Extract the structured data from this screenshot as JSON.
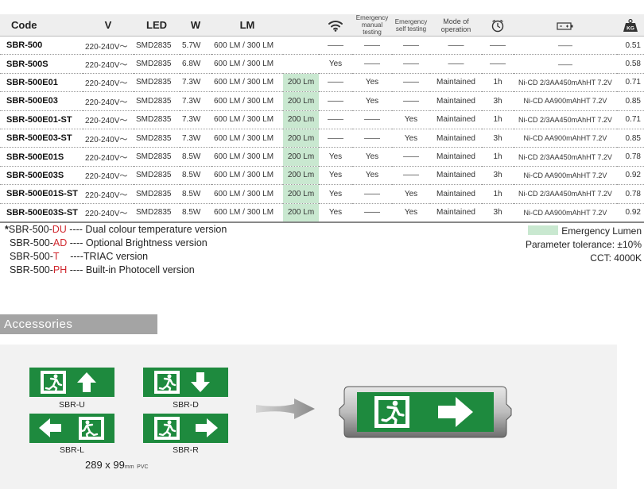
{
  "table": {
    "headers": {
      "code": "Code",
      "v": "V",
      "led": "LED",
      "w": "W",
      "lm": "LM",
      "wifi_icon": "wifi-icon",
      "em_manual": [
        "Emergency",
        "manual testing"
      ],
      "em_self": [
        "Emergency",
        "self testing"
      ],
      "mode": [
        "Mode of",
        "operation"
      ],
      "clock_icon": "clock-icon",
      "battery_icon": "battery-icon",
      "weight_icon": "weight-kg-icon",
      "weight_label": "KG"
    },
    "rows": [
      {
        "code": "SBR-500",
        "v": "220-240V～",
        "led": "SMD2835",
        "w": "5.7W",
        "lm": "600 LM / 300 LM",
        "em": "",
        "wifi": "——",
        "manual": "——",
        "self": "——",
        "mode": "——",
        "hours": "——",
        "battery": "——",
        "kg": "0.51"
      },
      {
        "code": "SBR-500S",
        "v": "220-240V～",
        "led": "SMD2835",
        "w": "6.8W",
        "lm": "600 LM / 300 LM",
        "em": "",
        "wifi": "Yes",
        "manual": "——",
        "self": "——",
        "mode": "——",
        "hours": "——",
        "battery": "——",
        "kg": "0.58"
      },
      {
        "code": "SBR-500E01",
        "v": "220-240V～",
        "led": "SMD2835",
        "w": "7.3W",
        "lm": "600 LM / 300 LM",
        "em": "200 Lm",
        "wifi": "——",
        "manual": "Yes",
        "self": "——",
        "mode": "Maintained",
        "hours": "1h",
        "battery": "Ni-CD 2/3AA450mAhHT 7.2V",
        "kg": "0.71"
      },
      {
        "code": "SBR-500E03",
        "v": "220-240V～",
        "led": "SMD2835",
        "w": "7.3W",
        "lm": "600 LM / 300 LM",
        "em": "200 Lm",
        "wifi": "——",
        "manual": "Yes",
        "self": "——",
        "mode": "Maintained",
        "hours": "3h",
        "battery": "Ni-CD AA900mAhHT 7.2V",
        "kg": "0.85"
      },
      {
        "code": "SBR-500E01-ST",
        "v": "220-240V～",
        "led": "SMD2835",
        "w": "7.3W",
        "lm": "600 LM / 300 LM",
        "em": "200 Lm",
        "wifi": "——",
        "manual": "——",
        "self": "Yes",
        "mode": "Maintained",
        "hours": "1h",
        "battery": "Ni-CD 2/3AA450mAhHT 7.2V",
        "kg": "0.71"
      },
      {
        "code": "SBR-500E03-ST",
        "v": "220-240V～",
        "led": "SMD2835",
        "w": "7.3W",
        "lm": "600 LM / 300 LM",
        "em": "200 Lm",
        "wifi": "——",
        "manual": "——",
        "self": "Yes",
        "mode": "Maintained",
        "hours": "3h",
        "battery": "Ni-CD AA900mAhHT 7.2V",
        "kg": "0.85"
      },
      {
        "code": "SBR-500E01S",
        "v": "220-240V～",
        "led": "SMD2835",
        "w": "8.5W",
        "lm": "600 LM / 300 LM",
        "em": "200 Lm",
        "wifi": "Yes",
        "manual": "Yes",
        "self": "——",
        "mode": "Maintained",
        "hours": "1h",
        "battery": "Ni-CD 2/3AA450mAhHT 7.2V",
        "kg": "0.78"
      },
      {
        "code": "SBR-500E03S",
        "v": "220-240V～",
        "led": "SMD2835",
        "w": "8.5W",
        "lm": "600 LM / 300 LM",
        "em": "200 Lm",
        "wifi": "Yes",
        "manual": "Yes",
        "self": "——",
        "mode": "Maintained",
        "hours": "3h",
        "battery": "Ni-CD AA900mAhHT 7.2V",
        "kg": "0.92"
      },
      {
        "code": "SBR-500E01S-ST",
        "v": "220-240V～",
        "led": "SMD2835",
        "w": "8.5W",
        "lm": "600 LM / 300 LM",
        "em": "200 Lm",
        "wifi": "Yes",
        "manual": "——",
        "self": "Yes",
        "mode": "Maintained",
        "hours": "1h",
        "battery": "Ni-CD 2/3AA450mAhHT 7.2V",
        "kg": "0.78"
      },
      {
        "code": "SBR-500E03S-ST",
        "v": "220-240V～",
        "led": "SMD2835",
        "w": "8.5W",
        "lm": "600 LM / 300 LM",
        "em": "200 Lm",
        "wifi": "Yes",
        "manual": "——",
        "self": "Yes",
        "mode": "Maintained",
        "hours": "3h",
        "battery": "Ni-CD AA900mAhHT 7.2V",
        "kg": "0.92"
      }
    ]
  },
  "notes": [
    {
      "star": "*",
      "prefix": "SBR-500-",
      "suffix": "DU",
      "text": " ---- Dual colour temperature version"
    },
    {
      "star": "",
      "prefix": "SBR-500-",
      "suffix": "AD",
      "text": " ---- Optional Brightness version"
    },
    {
      "star": "",
      "prefix": "SBR-500-",
      "suffix": "T",
      "text": "    ----TRIAC version"
    },
    {
      "star": "",
      "prefix": "SBR-500-",
      "suffix": "PH",
      "text": " ---- Built-in Photocell version"
    }
  ],
  "legend": {
    "emergency": "Emergency  Lumen",
    "tolerance": "Parameter tolerance: ±10%",
    "cct": "CCT: 4000K"
  },
  "accessories": {
    "title": "Accessories",
    "signs": [
      {
        "label": "SBR-U",
        "arrow": "arrow-up-icon"
      },
      {
        "label": "SBR-D",
        "arrow": "arrow-down-icon"
      },
      {
        "label": "SBR-L",
        "arrow": "arrow-left-icon"
      },
      {
        "label": "SBR-R",
        "arrow": "arrow-right-icon"
      }
    ],
    "size": "289 x 99",
    "size_unit": "mm",
    "material": "PVC",
    "colors": {
      "sign_green": "#1e8a3e",
      "em_highlight": "#c9e8d0",
      "note_red": "#d0262d"
    }
  }
}
